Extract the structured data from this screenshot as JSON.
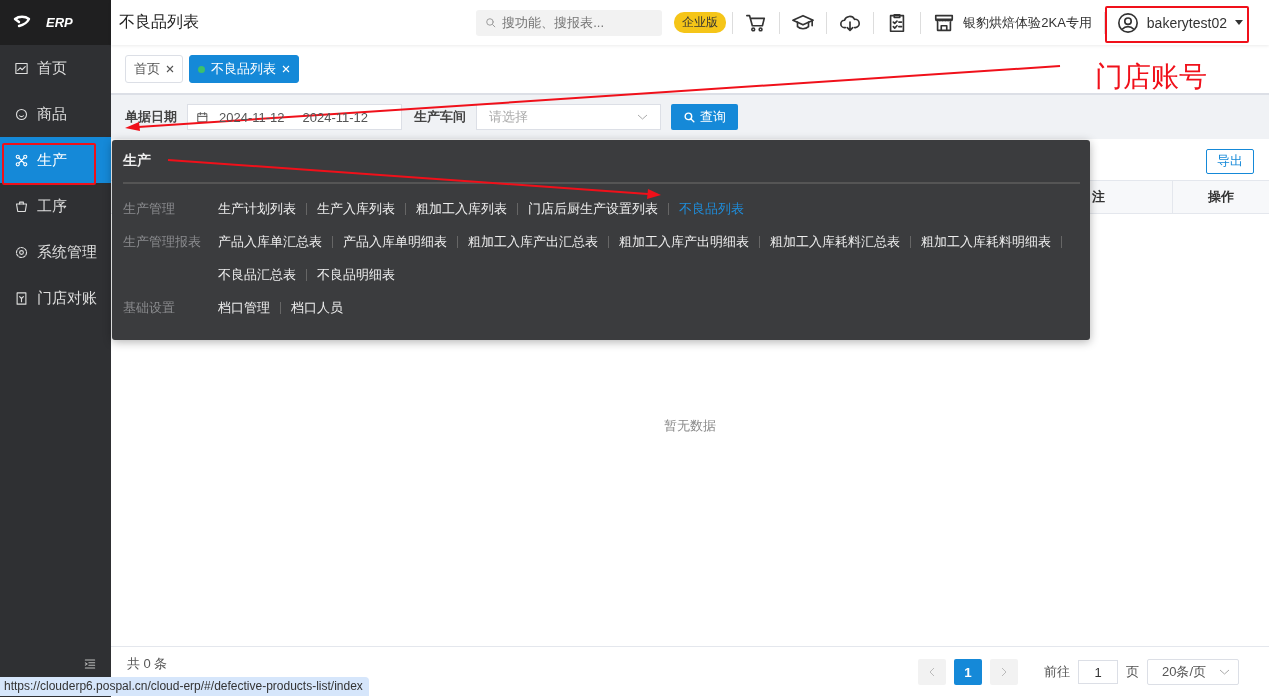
{
  "sidebar": {
    "logo": "ERP",
    "items": [
      {
        "label": "首页",
        "selected": false
      },
      {
        "label": "商品",
        "selected": false
      },
      {
        "label": "生产",
        "selected": true
      },
      {
        "label": "工序",
        "selected": false
      },
      {
        "label": "系统管理",
        "selected": false
      },
      {
        "label": "门店对账",
        "selected": false
      }
    ]
  },
  "header": {
    "title": "不良品列表",
    "search_placeholder": "搜功能、搜报表...",
    "badge": "企业版",
    "store": "银豹烘焙体验2KA专用",
    "user": "bakerytest02"
  },
  "tabs": [
    {
      "label": "首页",
      "selected": false
    },
    {
      "label": "不良品列表",
      "selected": true
    }
  ],
  "filters": {
    "date_label": "单据日期",
    "date_start": "2024-11-12",
    "date_end": "2024-11-12",
    "workshop_label": "生产车间",
    "workshop_placeholder": "请选择",
    "query_button": "查询"
  },
  "toolbar": {
    "export_button": "导出"
  },
  "table": {
    "columns": [
      "注",
      "操作"
    ],
    "empty_text": "暂无数据"
  },
  "footer": {
    "total": "共 0 条",
    "pages": [
      {
        "label": "1",
        "selected": true
      }
    ],
    "goto_label": "前往",
    "goto_value": "1",
    "page_unit": "页",
    "page_size": "20条/页"
  },
  "menu_popup": {
    "title": "生产",
    "sections": [
      {
        "label": "生产管理",
        "links": [
          {
            "text": "生产计划列表",
            "selected": false
          },
          {
            "text": "生产入库列表",
            "selected": false
          },
          {
            "text": "粗加工入库列表",
            "selected": false
          },
          {
            "text": "门店后厨生产设置列表",
            "selected": false
          },
          {
            "text": "不良品列表",
            "selected": true
          }
        ]
      },
      {
        "label": "生产管理报表",
        "links": [
          {
            "text": "产品入库单汇总表",
            "selected": false
          },
          {
            "text": "产品入库单明细表",
            "selected": false
          },
          {
            "text": "粗加工入库产出汇总表",
            "selected": false
          },
          {
            "text": "粗加工入库产出明细表",
            "selected": false
          },
          {
            "text": "粗加工入库耗料汇总表",
            "selected": false
          },
          {
            "text": "粗加工入库耗料明细表",
            "selected": false
          },
          {
            "text": "不良品汇总表",
            "selected": false
          },
          {
            "text": "不良品明细表",
            "selected": false
          }
        ]
      },
      {
        "label": "基础设置",
        "links": [
          {
            "text": "档口管理",
            "selected": false
          },
          {
            "text": "档口人员",
            "selected": false
          }
        ]
      }
    ]
  },
  "annotation": {
    "label": "门店账号"
  },
  "status_url": "https://clouderp6.pospal.cn/cloud-erp/#/defective-products-list/index"
}
